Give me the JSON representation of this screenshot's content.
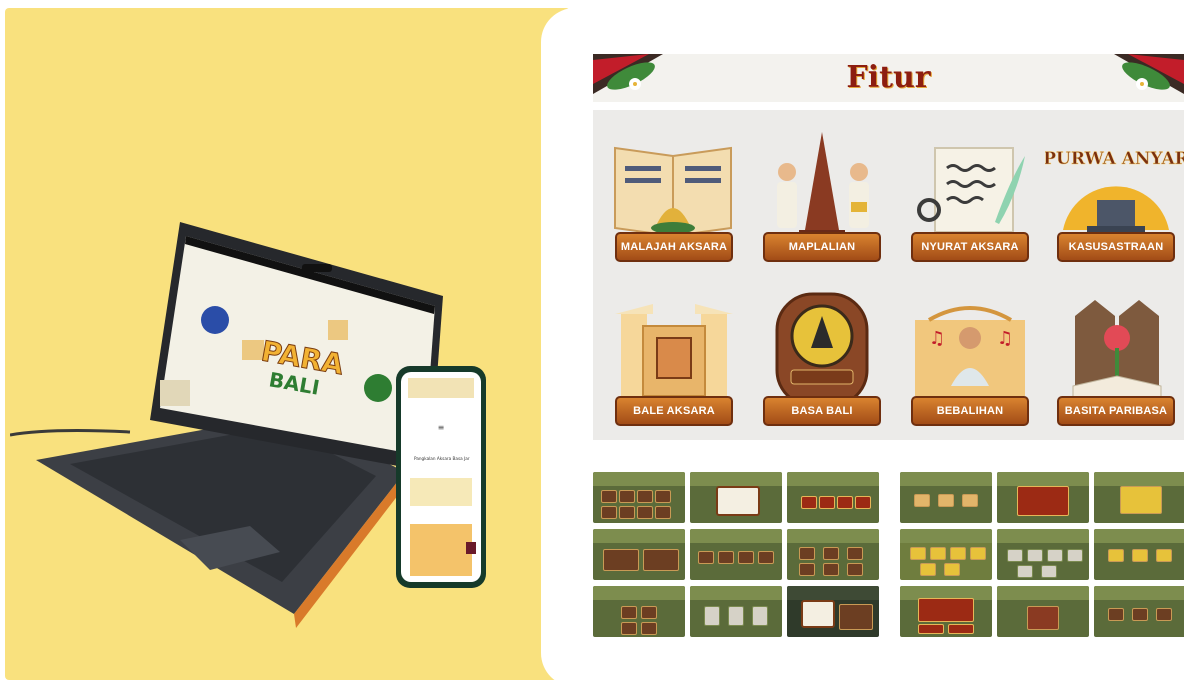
{
  "fitur": {
    "title": "Fitur"
  },
  "features": [
    {
      "label": "MALAJAH AKSARA",
      "icon": "open-book-icon"
    },
    {
      "label": "MAPLALIAN",
      "icon": "dancers-temple-icon"
    },
    {
      "label": "NYURAT AKSARA",
      "icon": "scroll-quill-icon"
    },
    {
      "label": "KASUSASTRAAN",
      "icon": "purwa-anyar-icon"
    },
    {
      "label": "BALE AKSARA",
      "icon": "temple-gate-icon"
    },
    {
      "label": "BASA BALI",
      "icon": "emblem-plaque-icon"
    },
    {
      "label": "BEBALIHAN",
      "icon": "singer-icon"
    },
    {
      "label": "BASITA PARIBASA",
      "icon": "flower-book-icon"
    }
  ],
  "logo": {
    "laptop_title": "PARA",
    "laptop_subtitle": "BALI"
  },
  "kasusastraan_art_text": "PURWA ANYAR",
  "phone": {
    "menu_item": "Pangkalan Aksara Basa Jar"
  },
  "colors": {
    "left_bg": "#f9e17e",
    "title": "#8c1d10",
    "plaque": "#b85e1f",
    "grid_bg": "#ecebe9"
  }
}
